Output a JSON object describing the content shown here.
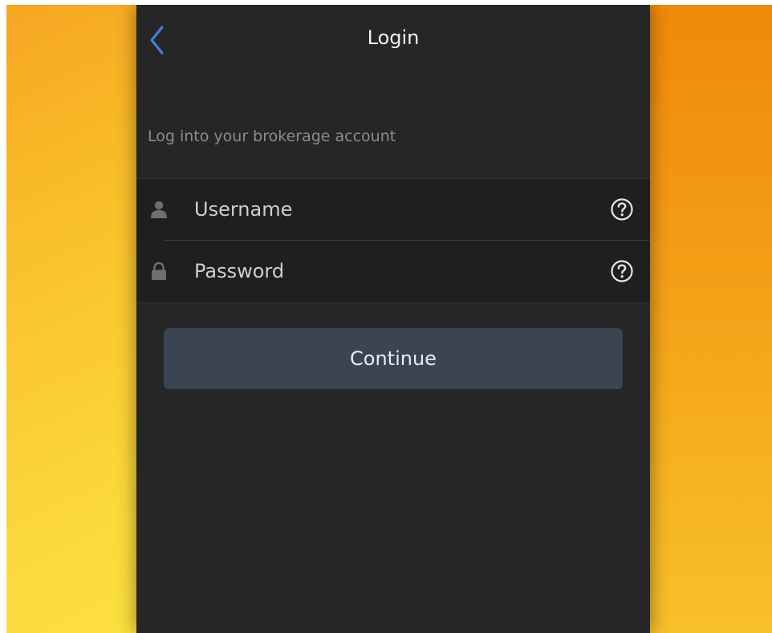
{
  "navbar": {
    "title": "Login",
    "back_icon": "chevron-left-icon",
    "back_color": "#4a7fd4"
  },
  "section": {
    "header": "Log into your brokerage account"
  },
  "form": {
    "username": {
      "placeholder": "Username",
      "value": "",
      "icon": "user-icon",
      "help_icon": "question-circle-icon"
    },
    "password": {
      "placeholder": "Password",
      "value": "",
      "icon": "lock-icon",
      "help_icon": "question-circle-icon"
    }
  },
  "actions": {
    "continue_label": "Continue"
  },
  "colors": {
    "screen_bg": "#262626",
    "form_bg": "#1f1f1f",
    "button_bg": "#3a4453",
    "accent": "#4a7fd4",
    "background_gradient_top": "#f08a0a",
    "background_gradient_bottom": "#fdef4a"
  }
}
